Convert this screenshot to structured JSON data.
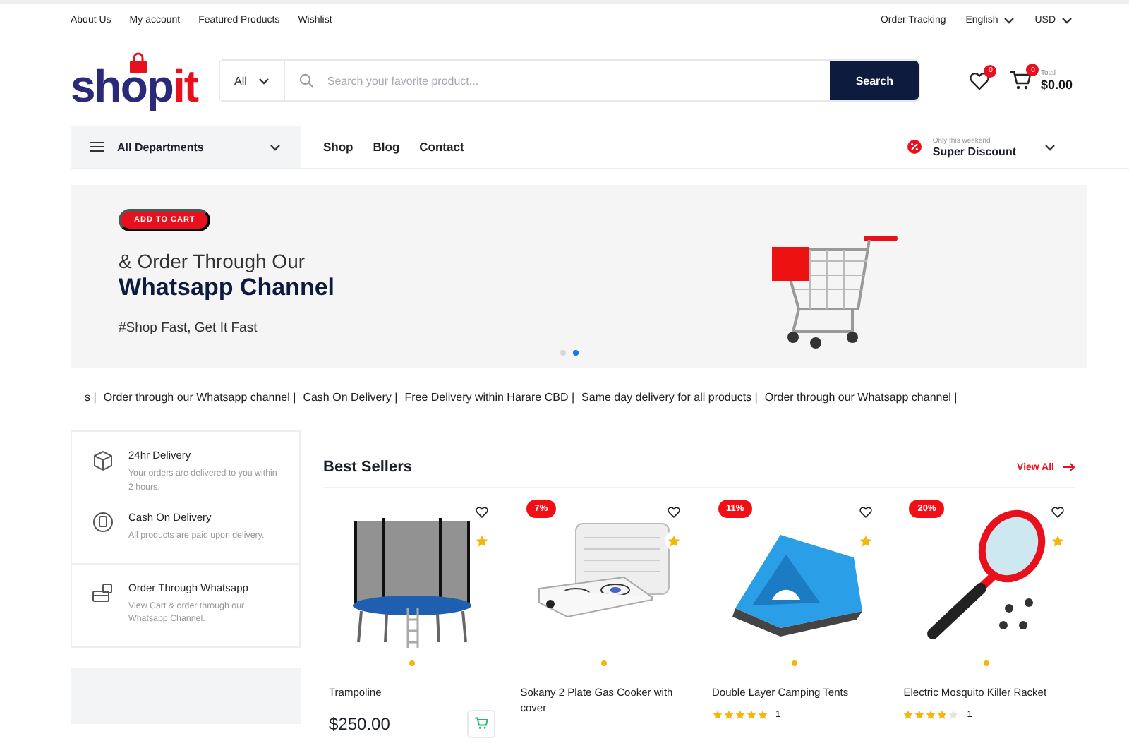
{
  "top_bar": {
    "links": [
      "About Us",
      "My account",
      "Featured Products",
      "Wishlist"
    ],
    "right": [
      {
        "label": "Order Tracking",
        "dropdown": false
      },
      {
        "label": "English",
        "dropdown": true
      },
      {
        "label": "USD",
        "dropdown": true
      }
    ]
  },
  "header": {
    "logo": {
      "text": "shop",
      "accent": "it"
    },
    "search": {
      "category": "All",
      "placeholder": "Search your favorite product...",
      "button": "Search"
    },
    "wishlist_count": "0",
    "cart_count": "0",
    "total_label": "Total",
    "total": "$0.00"
  },
  "nav": {
    "departments": "All Departments",
    "links": [
      "Shop",
      "Blog",
      "Contact"
    ],
    "promo_small": "Only this weekend",
    "promo": "Super Discount"
  },
  "hero": {
    "badge": "ADD TO CART",
    "line1": "& Order Through Our",
    "line2": "Whatsapp Channel",
    "tagline": "#Shop Fast, Get It Fast",
    "dots": [
      {
        "selected": false
      },
      {
        "selected": true
      }
    ]
  },
  "ticker": [
    "s |",
    "Order through our Whatsapp channel |",
    "Cash On Delivery |",
    "Free Delivery within Harare CBD |",
    "Same day delivery for all products |",
    "Order through our Whatsapp channel |"
  ],
  "features": [
    {
      "kind": "box",
      "title": "24hr Delivery",
      "text": "Your orders are delivered to you within 2 hours."
    },
    {
      "kind": "phone",
      "title": "Cash On Delivery",
      "text": "All products are paid upon delivery."
    },
    {
      "kind": "cart",
      "title": "Order Through Whatsapp",
      "text": "View Cart & order through our Whatsapp Channel."
    }
  ],
  "best_sellers": {
    "title": "Best Sellers",
    "view_all": "View All",
    "products": [
      {
        "kind": "trampoline",
        "name": "Trampoline",
        "price": "$250.00"
      },
      {
        "kind": "stove",
        "name": "Sokany 2 Plate Gas Cooker with cover",
        "discount": "7%"
      },
      {
        "kind": "tent",
        "name": "Double Layer Camping Tents",
        "discount": "11%",
        "stars": 5,
        "reviews": "1"
      },
      {
        "kind": "racket",
        "name": "Electric Mosquito Killer Racket",
        "discount": "20%",
        "stars": 4,
        "reviews": "1"
      }
    ]
  }
}
